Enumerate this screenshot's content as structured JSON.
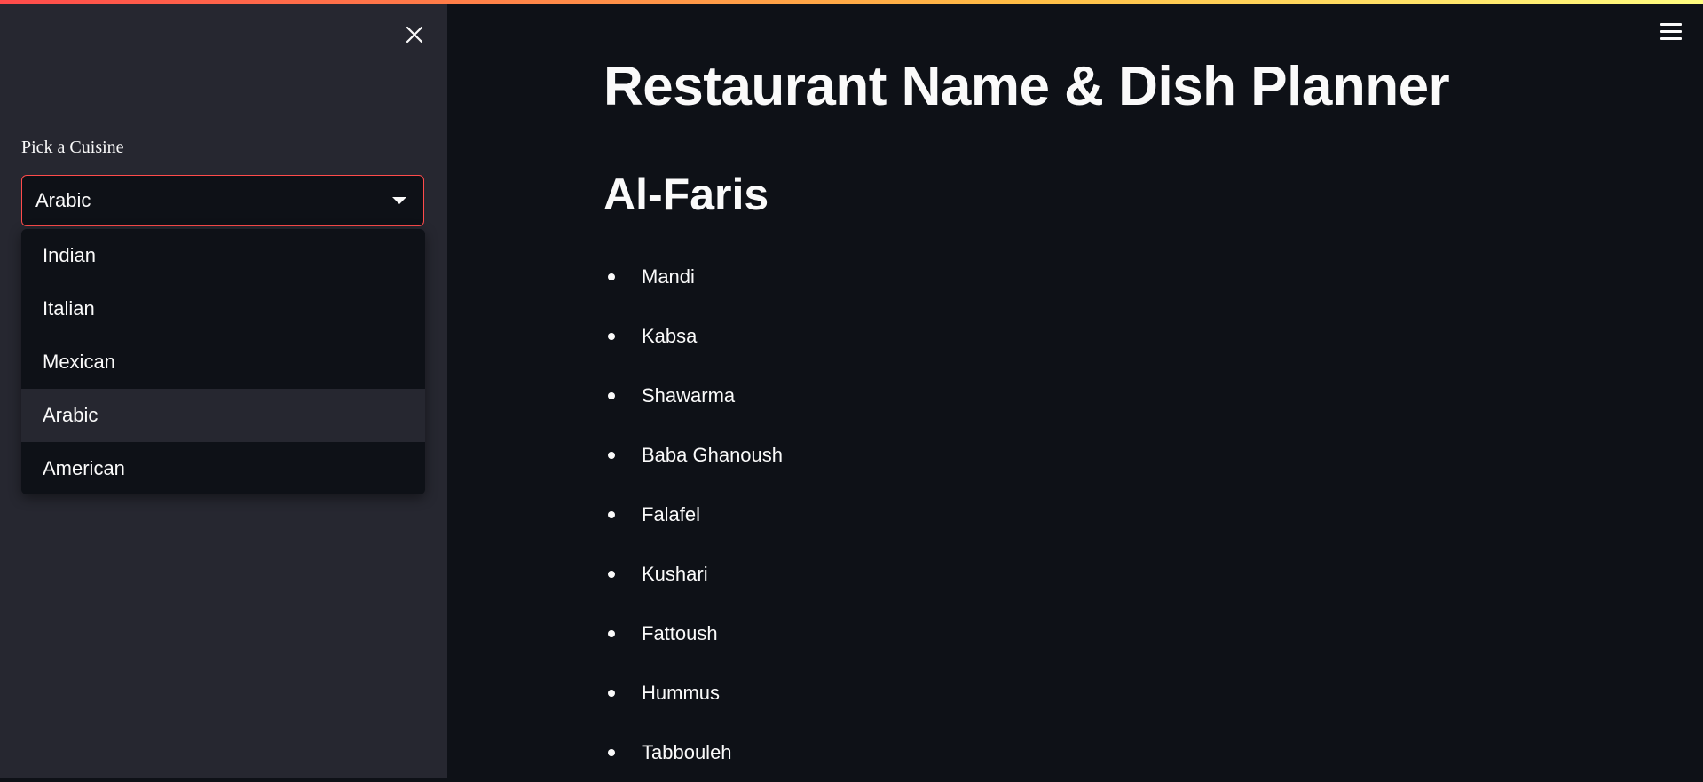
{
  "sidebar": {
    "close_icon": "close-icon",
    "cuisine_label": "Pick a Cuisine",
    "selected_value": "Arabic",
    "options": [
      "Indian",
      "Italian",
      "Mexican",
      "Arabic",
      "American"
    ],
    "selected_index": 3
  },
  "main": {
    "menu_icon": "hamburger-menu-icon",
    "title": "Restaurant Name & Dish Planner",
    "restaurant_name": "Al-Faris",
    "dishes": [
      "Mandi",
      "Kabsa",
      "Shawarma",
      "Baba Ghanoush",
      "Falafel",
      "Kushari",
      "Fattoush",
      "Hummus",
      "Tabbouleh"
    ]
  },
  "colors": {
    "accent": "#ff4b4b",
    "sidebar_bg": "#262730",
    "main_bg": "#0e1117",
    "text": "#fafafa"
  }
}
